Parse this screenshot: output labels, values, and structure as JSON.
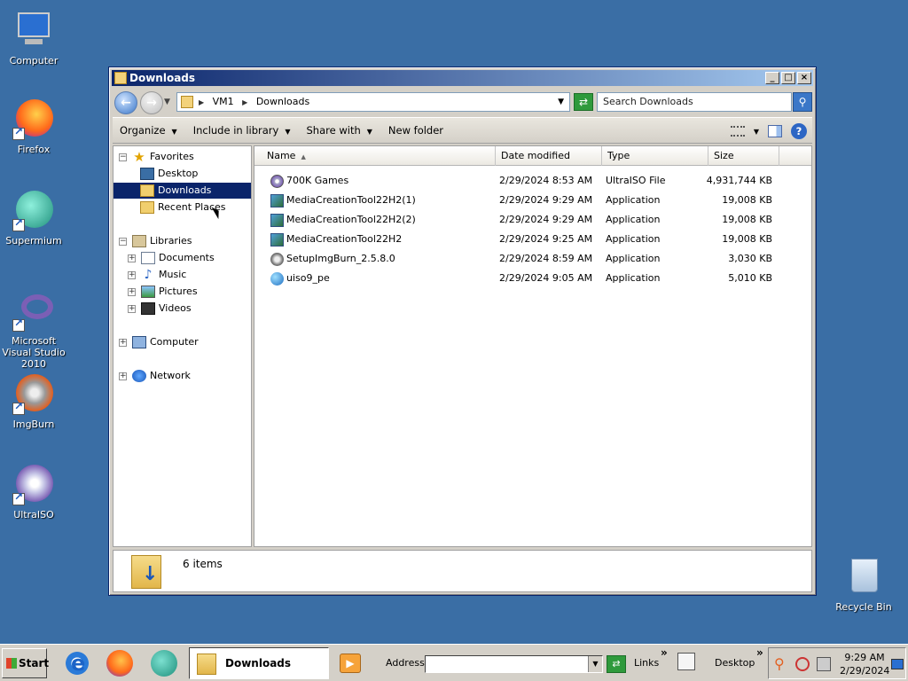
{
  "desktop": {
    "icons": [
      {
        "label": "Computer"
      },
      {
        "label": "Firefox"
      },
      {
        "label": "Supermium"
      },
      {
        "label": "Microsoft Visual Studio 2010"
      },
      {
        "label": "ImgBurn"
      },
      {
        "label": "UltraISO"
      },
      {
        "label": "Recycle Bin"
      }
    ]
  },
  "window": {
    "title": "Downloads",
    "address": {
      "crumbs": [
        "VM1",
        "Downloads"
      ]
    },
    "search_placeholder": "Search Downloads",
    "commands": {
      "organize": "Organize",
      "include_in_library": "Include in library",
      "share_with": "Share with",
      "new_folder": "New folder",
      "help": "?"
    },
    "nav": {
      "favorites": "Favorites",
      "desktop": "Desktop",
      "downloads": "Downloads",
      "recent_places": "Recent Places",
      "libraries": "Libraries",
      "documents": "Documents",
      "music": "Music",
      "pictures": "Pictures",
      "videos": "Videos",
      "computer": "Computer",
      "network": "Network"
    },
    "columns": {
      "name": "Name",
      "date_modified": "Date modified",
      "type": "Type",
      "size": "Size"
    },
    "files": [
      {
        "name": "700K Games",
        "date": "2/29/2024 8:53 AM",
        "type": "UltraISO File",
        "size": "4,931,744 KB",
        "icon": "disc-icon"
      },
      {
        "name": "MediaCreationTool22H2(1)",
        "date": "2/29/2024 9:29 AM",
        "type": "Application",
        "size": "19,008 KB",
        "icon": "app-icon"
      },
      {
        "name": "MediaCreationTool22H2(2)",
        "date": "2/29/2024 9:29 AM",
        "type": "Application",
        "size": "19,008 KB",
        "icon": "app-icon"
      },
      {
        "name": "MediaCreationTool22H2",
        "date": "2/29/2024 9:25 AM",
        "type": "Application",
        "size": "19,008 KB",
        "icon": "app-icon"
      },
      {
        "name": "SetupImgBurn_2.5.8.0",
        "date": "2/29/2024 8:59 AM",
        "type": "Application",
        "size": "3,030 KB",
        "icon": "burn-icon"
      },
      {
        "name": "uiso9_pe",
        "date": "2/29/2024 9:05 AM",
        "type": "Application",
        "size": "5,010 KB",
        "icon": "globe-icon"
      }
    ],
    "status": {
      "item_count": "6 items"
    }
  },
  "taskbar": {
    "start_label": "Start",
    "active_window": "Downloads",
    "address_label": "Address",
    "address_value": "",
    "links_label": "Links",
    "desktop_label": "Desktop",
    "chevron": "»",
    "clock_time": "9:29 AM",
    "clock_date": "2/29/2024"
  }
}
